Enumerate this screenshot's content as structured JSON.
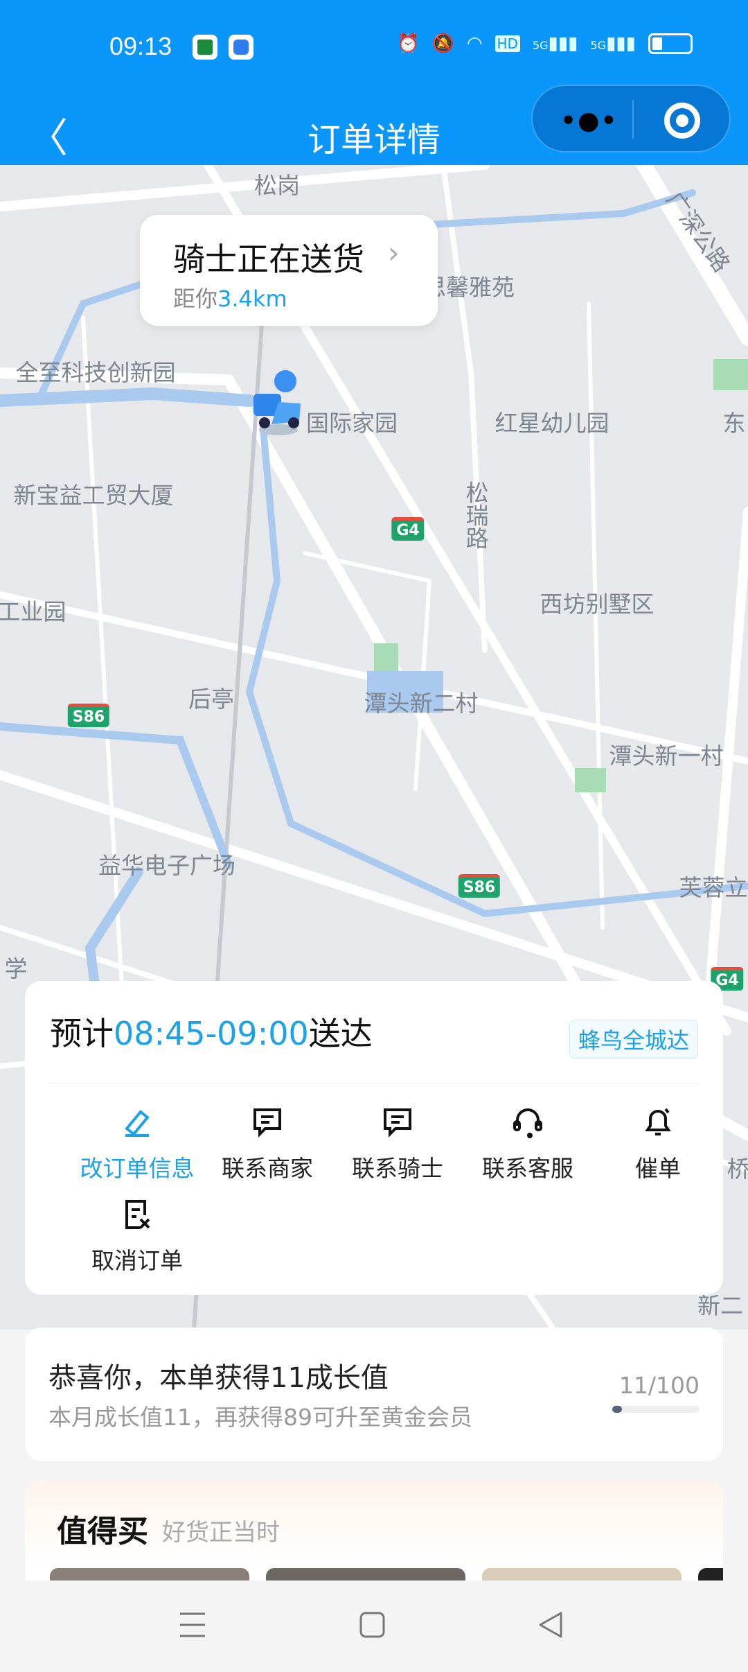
{
  "status_bar": {
    "time": "09:13",
    "icons": [
      "china-post-app-icon",
      "browser-app-icon",
      "alarm-icon",
      "mute-icon",
      "wifi-icon",
      "hd-icon",
      "5g-signal-icon",
      "5g-signal-icon",
      "battery-icon"
    ],
    "hd": "HD",
    "net1": "5G",
    "net2": "5G"
  },
  "header": {
    "title": "订单详情",
    "back_icon": "chevron-left-icon",
    "more_icon": "more-dots-icon",
    "close_icon": "target-circle-icon"
  },
  "map": {
    "labels": [
      "松岗",
      "思馨雅苑",
      "广深公路",
      "全至科技创新园",
      "国际家园",
      "红星幼儿园",
      "东",
      "新宝益工贸大厦",
      "松瑞路",
      "工业园",
      "西坊别墅区",
      "后亭",
      "潭头新二村",
      "潭头新一村",
      "益华电子广场",
      "芙蓉立",
      "学",
      "桥",
      "新二"
    ],
    "road_badges": [
      "G4",
      "S86",
      "S86",
      "G4"
    ],
    "rider_bubble": {
      "title": "骑士正在送货",
      "distance_prefix": "距你",
      "distance": "3.4km"
    }
  },
  "delivery_card": {
    "eta_prefix": "预计",
    "eta_time": "08:45-09:00",
    "eta_suffix": "送达",
    "service_tag": "蜂鸟全城达",
    "actions": [
      {
        "label": "改订单信息",
        "icon": "pencil-edit-icon",
        "active": true
      },
      {
        "label": "联系商家",
        "icon": "chat-icon"
      },
      {
        "label": "联系骑士",
        "icon": "chat-icon"
      },
      {
        "label": "联系客服",
        "icon": "headset-icon"
      },
      {
        "label": "催单",
        "icon": "bell-icon"
      },
      {
        "label": "取消订单",
        "icon": "cancel-order-icon"
      }
    ],
    "accent": "#1aa1e8"
  },
  "growth_card": {
    "title": "恭喜你，本单获得11成长值",
    "subtitle": "本月成长值11，再获得89可升至黄金会员",
    "count": "11/100",
    "progress": 0.11
  },
  "recommend": {
    "title": "值得买",
    "subtitle": "好货正当时"
  },
  "system_nav": [
    "menu-icon",
    "home-square-icon",
    "back-triangle-icon"
  ]
}
